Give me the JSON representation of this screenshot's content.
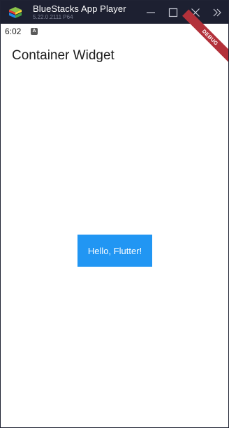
{
  "window": {
    "title": "BlueStacks App Player",
    "version": "5.22.0.2111 P64",
    "controls": [
      "minimize",
      "maximize",
      "close",
      "expand-more"
    ]
  },
  "statusbar": {
    "time": "6:02",
    "indicator": "A"
  },
  "appbar": {
    "title": "Container Widget"
  },
  "debug_banner": {
    "label": "DEBUG",
    "color": "#b3313a"
  },
  "container": {
    "text": "Hello, Flutter!",
    "color": "#2196f3"
  },
  "colors": {
    "titlebar_bg": "#1d2031",
    "page_bg": "#ffffff"
  }
}
